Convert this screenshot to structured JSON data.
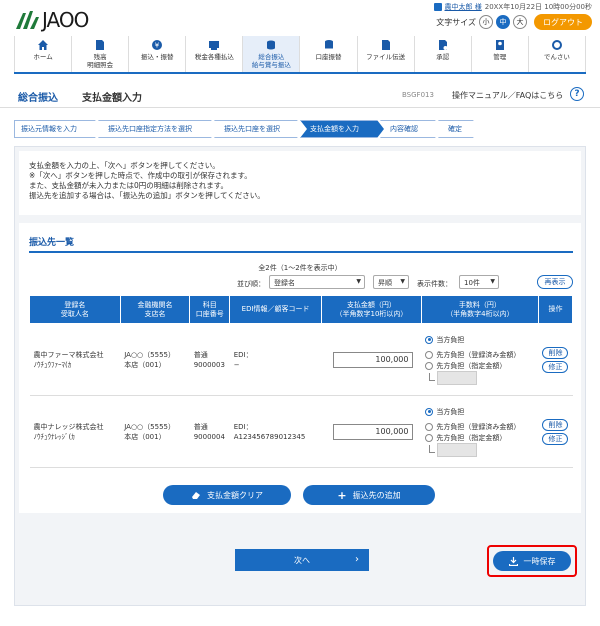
{
  "header": {
    "logo_text": "JAOO",
    "user_name": "農中太郎 様",
    "login_time": "20XX年10月22日 10時00分00秒",
    "font_size_label": "文字サイズ",
    "font_sizes": [
      "小",
      "中",
      "大"
    ],
    "logout_label": "ログアウト"
  },
  "nav": {
    "items": [
      {
        "label": "ホーム"
      },
      {
        "label": "残高\n明細照会"
      },
      {
        "label": "振込・振替"
      },
      {
        "label": "税金各種払込"
      },
      {
        "label": "総合振込\n給与賞与振込"
      },
      {
        "label": "口座振替"
      },
      {
        "label": "ファイル伝送"
      },
      {
        "label": "承認"
      },
      {
        "label": "管理"
      },
      {
        "label": "でんさい"
      }
    ]
  },
  "title_bar": {
    "category": "総合振込",
    "title": "支払金額入力",
    "code": "BSGF013",
    "help_text": "操作マニュアル／FAQはこちら"
  },
  "steps": [
    "振込元情報を入力",
    "振込先口座指定方法を選択",
    "振込先口座を選択",
    "支払金額を入力",
    "内容確認",
    "確定"
  ],
  "intro": {
    "lines": [
      "支払金額を入力の上、「次へ」ボタンを押してください。",
      "※「次へ」ボタンを押した時点で、作成中の取引が保存されます。",
      "また、支払金額が未入力または0円の明細は削除されます。",
      "振込先を追加する場合は、「振込先の追加」ボタンを押してください。"
    ]
  },
  "list": {
    "title": "振込先一覧",
    "count_text": "全2件（1〜2件を表示中）",
    "sort_label": "並び順：",
    "sort_value": "登録名",
    "order_value": "昇順",
    "per_page_label": "表示件数：",
    "per_page_value": "10件",
    "redisplay_label": "再表示",
    "headers": [
      "登録名\n受取人名",
      "金融機関名\n支店名",
      "科目\n口座番号",
      "EDI情報／顧客コード",
      "支払金額（円）\n（半角数字10桁以内）",
      "手数料（円）\n（半角数字4桁以内）",
      "操作"
    ],
    "rows": [
      {
        "name": "農中ファーマ株式会社",
        "kana": "ﾉｳﾁｭｳﾌｧｰﾏ(ｶ",
        "bank": "JA○○（5555）",
        "branch": "本店（001）",
        "type": "普通",
        "account": "9000003",
        "edi_label": "EDI：",
        "edi_value": "−",
        "amount": "100,000",
        "fee_options": [
          "当方負担",
          "先方負担（登録済み金額）",
          "先方負担（指定金額）"
        ],
        "delete_label": "削除",
        "edit_label": "修正"
      },
      {
        "name": "農中ナレッジ株式会社",
        "kana": "ﾉｳﾁｭｳﾅﾚｯｼﾞ(ｶ",
        "bank": "JA○○（5555）",
        "branch": "本店（001）",
        "type": "普通",
        "account": "9000004",
        "edi_label": "EDI：",
        "edi_value": "A123456789012345",
        "amount": "100,000",
        "fee_options": [
          "当方負担",
          "先方負担（登録済み金額）",
          "先方負担（指定金額）"
        ],
        "delete_label": "削除",
        "edit_label": "修正"
      }
    ],
    "clear_label": "支払金額クリア",
    "add_label": "振込先の追加"
  },
  "footer": {
    "next_label": "次へ",
    "save_label": "一時保存"
  },
  "colors": {
    "primary": "#1a6bc1",
    "logout": "#f39800",
    "highlight": "#e00000"
  }
}
